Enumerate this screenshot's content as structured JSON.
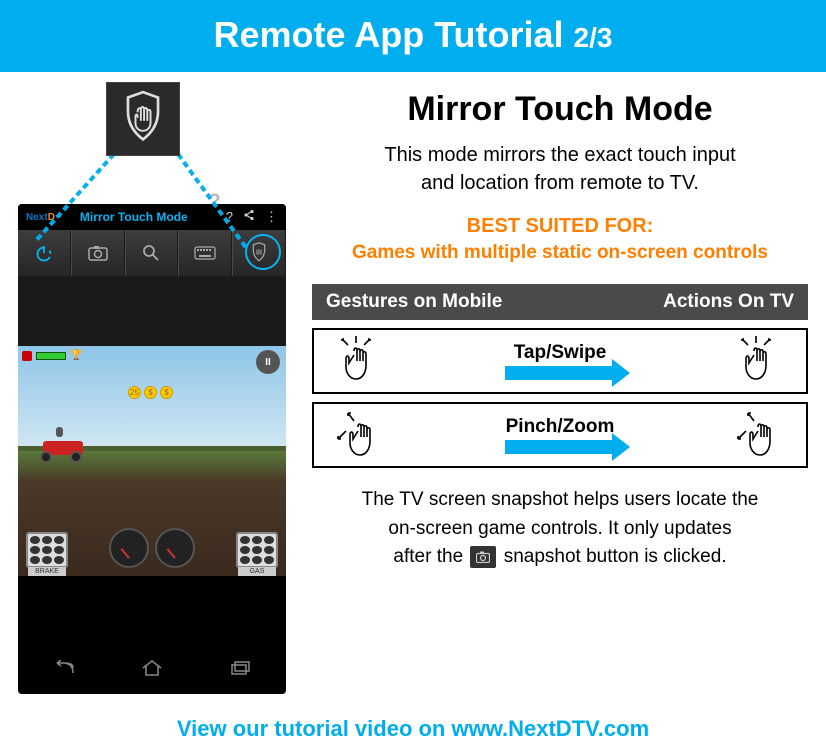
{
  "banner": {
    "title": "Remote App Tutorial ",
    "page": "2/3"
  },
  "main": {
    "title": "Mirror Touch Mode",
    "description_l1": "This mode mirrors the exact touch input",
    "description_l2": "and location from remote to TV.",
    "best_label": "BEST SUITED FOR:",
    "best_text": "Games with multiple static on-screen controls"
  },
  "table": {
    "col1": "Gestures on Mobile",
    "col2": "Actions On TV",
    "rows": [
      {
        "label": "Tap/Swipe"
      },
      {
        "label": "Pinch/Zoom"
      }
    ]
  },
  "snapshot": {
    "l1": "The TV screen snapshot helps users locate the",
    "l2": "on-screen game controls. It only updates",
    "l3a": "after the ",
    "l3b": " snapshot button is clicked."
  },
  "footer": "View our tutorial video on www.NextDTV.com",
  "phone": {
    "logo_next": "Next",
    "logo_d": "D",
    "tm": "™",
    "title": "Mirror Touch Mode",
    "icons": [
      "?",
      "share",
      "⋮"
    ],
    "pause": "II",
    "brake": "BRAKE",
    "gas": "GAS"
  }
}
